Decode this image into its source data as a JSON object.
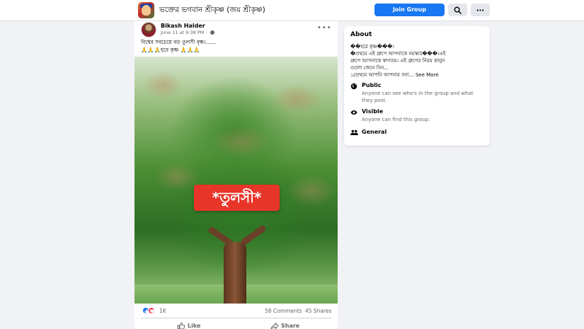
{
  "header": {
    "group_name": "ভক্তের ভগবান শ্রীকৃষ্ণ (জয় শ্রীকৃষ্ণ)",
    "join_label": "Join Group",
    "search_icon": "search-icon",
    "more_icon": "more-icon",
    "accent_color": "#1877f2"
  },
  "post": {
    "author": "Bikash Halder",
    "timestamp": "June 11 at 9:38 PM",
    "separator": " · ",
    "privacy_icon": "globe-icon",
    "menu": "•••",
    "caption_line1": "বিশ্বের সবচেয়ে বড় তুলসী বৃক্ষ।......",
    "caption_line2_prefix": "🙏🙏🙏",
    "caption_line2_text": "হরে কৃষ্ণ",
    "caption_line2_suffix": "🙏🙏🙏",
    "image_tag": "*তুলসী*",
    "reactions": [
      "like-icon",
      "love-icon"
    ],
    "reaction_count": "1K",
    "comments": "58 Comments",
    "shares": "45 Shares",
    "actions": {
      "like": "Like",
      "share": "Share"
    }
  },
  "about": {
    "title": "About",
    "description_line1": "��হরে কৃষ্ণ���।",
    "description_line2": "�প্রথমে এই গ্রুপে আপনাকে নমস্কার���।এই",
    "description_line3": "গ্রুপে আপনাকে স্বাগতম। এই গ্রুপের নিয়ম কানুন",
    "description_line4": "গুলো জেনে নিন...",
    "description_line5": "১/প্রথমে আপনি আপনার সন্য...",
    "see_more": "See More",
    "items": [
      {
        "icon": "globe-icon",
        "title": "Public",
        "description": "Anyone can see who's in the group and what they post."
      },
      {
        "icon": "eye-icon",
        "title": "Visible",
        "description": "Anyone can find this group."
      },
      {
        "icon": "people-icon",
        "title": "General",
        "description": ""
      }
    ]
  }
}
